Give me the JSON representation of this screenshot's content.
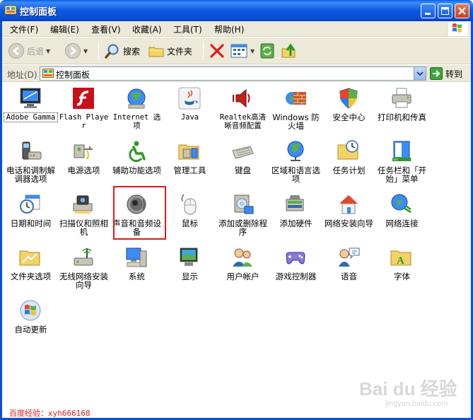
{
  "window": {
    "title": "控制面板"
  },
  "menu": [
    {
      "label": "文件(F)"
    },
    {
      "label": "编辑(E)"
    },
    {
      "label": "查看(V)"
    },
    {
      "label": "收藏(A)"
    },
    {
      "label": "工具(T)"
    },
    {
      "label": "帮助(H)"
    }
  ],
  "toolbar": {
    "back_label": "后退",
    "search_label": "搜索",
    "folders_label": "文件夹"
  },
  "address": {
    "label": "地址(D)",
    "value": "控制面板",
    "go_label": "转到"
  },
  "items": [
    {
      "label": "Adobe Gamma",
      "icon": "monitor-gamma-icon"
    },
    {
      "label": "Flash Player",
      "icon": "flash-icon"
    },
    {
      "label": "Internet 选项",
      "icon": "internet-globe-icon"
    },
    {
      "label": "Java",
      "icon": "java-icon"
    },
    {
      "label": "Realtek高清晰音频配置",
      "icon": "speaker-red-icon"
    },
    {
      "label": "Windows 防火墙",
      "icon": "firewall-icon"
    },
    {
      "label": "安全中心",
      "icon": "shield-icon"
    },
    {
      "label": "打印机和传真",
      "icon": "printer-icon"
    },
    {
      "label": "电话和调制解调器选项",
      "icon": "phone-modem-icon"
    },
    {
      "label": "电源选项",
      "icon": "power-icon"
    },
    {
      "label": "辅助功能选项",
      "icon": "accessibility-icon"
    },
    {
      "label": "管理工具",
      "icon": "admin-tools-icon"
    },
    {
      "label": "键盘",
      "icon": "keyboard-icon"
    },
    {
      "label": "区域和语言选项",
      "icon": "region-globe-icon"
    },
    {
      "label": "任务计划",
      "icon": "scheduled-tasks-icon"
    },
    {
      "label": "任务栏和「开始」菜单",
      "icon": "taskbar-icon"
    },
    {
      "label": "日期和时间",
      "icon": "clock-icon"
    },
    {
      "label": "扫描仪和照相机",
      "icon": "scanner-camera-icon"
    },
    {
      "label": "声音和音频设备",
      "icon": "speaker-icon"
    },
    {
      "label": "鼠标",
      "icon": "mouse-icon"
    },
    {
      "label": "添加或删除程序",
      "icon": "add-remove-icon"
    },
    {
      "label": "添加硬件",
      "icon": "add-hardware-icon"
    },
    {
      "label": "网络安装向导",
      "icon": "network-wizard-icon"
    },
    {
      "label": "网络连接",
      "icon": "network-connections-icon"
    },
    {
      "label": "文件夹选项",
      "icon": "folder-options-icon"
    },
    {
      "label": "无线网络安装向导",
      "icon": "wireless-icon"
    },
    {
      "label": "系统",
      "icon": "system-icon"
    },
    {
      "label": "显示",
      "icon": "display-icon"
    },
    {
      "label": "用户帐户",
      "icon": "user-accounts-icon"
    },
    {
      "label": "游戏控制器",
      "icon": "gamepad-icon"
    },
    {
      "label": "语音",
      "icon": "speech-icon"
    },
    {
      "label": "字体",
      "icon": "fonts-icon"
    },
    {
      "label": "自动更新",
      "icon": "windows-update-icon"
    }
  ],
  "footnote": "百度经验：xyh666168",
  "watermark": "Bai du 经验",
  "watermark_sub": "jingyan.baidu.com",
  "colors": {
    "titlebar": "#0a5ee6",
    "highlight": "#e31a1a",
    "menubar": "#ece9d8"
  }
}
